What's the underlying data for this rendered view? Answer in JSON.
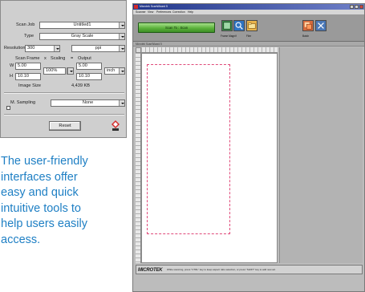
{
  "panel": {
    "scan_job_label": "Scan Job",
    "scan_job_value": "Untitled1",
    "type_label": "Type",
    "type_value": "Gray Scale",
    "resolution_label": "Resolution",
    "resolution_value": "300",
    "resolution_unit": "ppi",
    "header_frame": "Scan Frame",
    "header_sep1": "x",
    "header_scaling": "Scaling",
    "header_sep2": "=",
    "header_output": "Output",
    "w_label": "W",
    "w_input": "5.00",
    "w_output": "5.00",
    "h_label": "H",
    "h_input": "10.10",
    "h_output": "10.10",
    "scaling_value": "100%",
    "unit_value": "inch",
    "image_size_label": "Image Size",
    "image_size_value": "4,439 KB",
    "multi_sampling_label": "M. Sampling",
    "multi_sampling_value": "None",
    "reset_label": "Reset"
  },
  "caption": [
    "The user-friendly",
    "interfaces offer",
    "easy and quick",
    "intuitive tools to",
    "help users easily",
    "access."
  ],
  "window": {
    "title": "Microtek ScanWizard 5",
    "menus": [
      "Scanner",
      "View",
      "Preferences",
      "Correction",
      "Help"
    ],
    "scan_button": "Scan To : Scan",
    "tool_labels": [
      "Frame Magnif",
      "Filer",
      "Batch"
    ]
  },
  "statusbar": {
    "brand": "MICROTEK",
    "message": "While scanning, press \"CTRL\" key to keep aspect ratio selection, or press \"SHIFT\" key to add new ad."
  },
  "colors": {
    "caption_text": "#1e7fc4",
    "scan_button": "#5cb23c",
    "title_bar": "#21368a",
    "scan_frame": "#e04a7a"
  },
  "icons": {
    "app": "microtek-app-icon",
    "badge": "microtek-logo-badge",
    "tools": [
      "magnifier-icon",
      "filer-icon",
      "batch-icon"
    ]
  }
}
